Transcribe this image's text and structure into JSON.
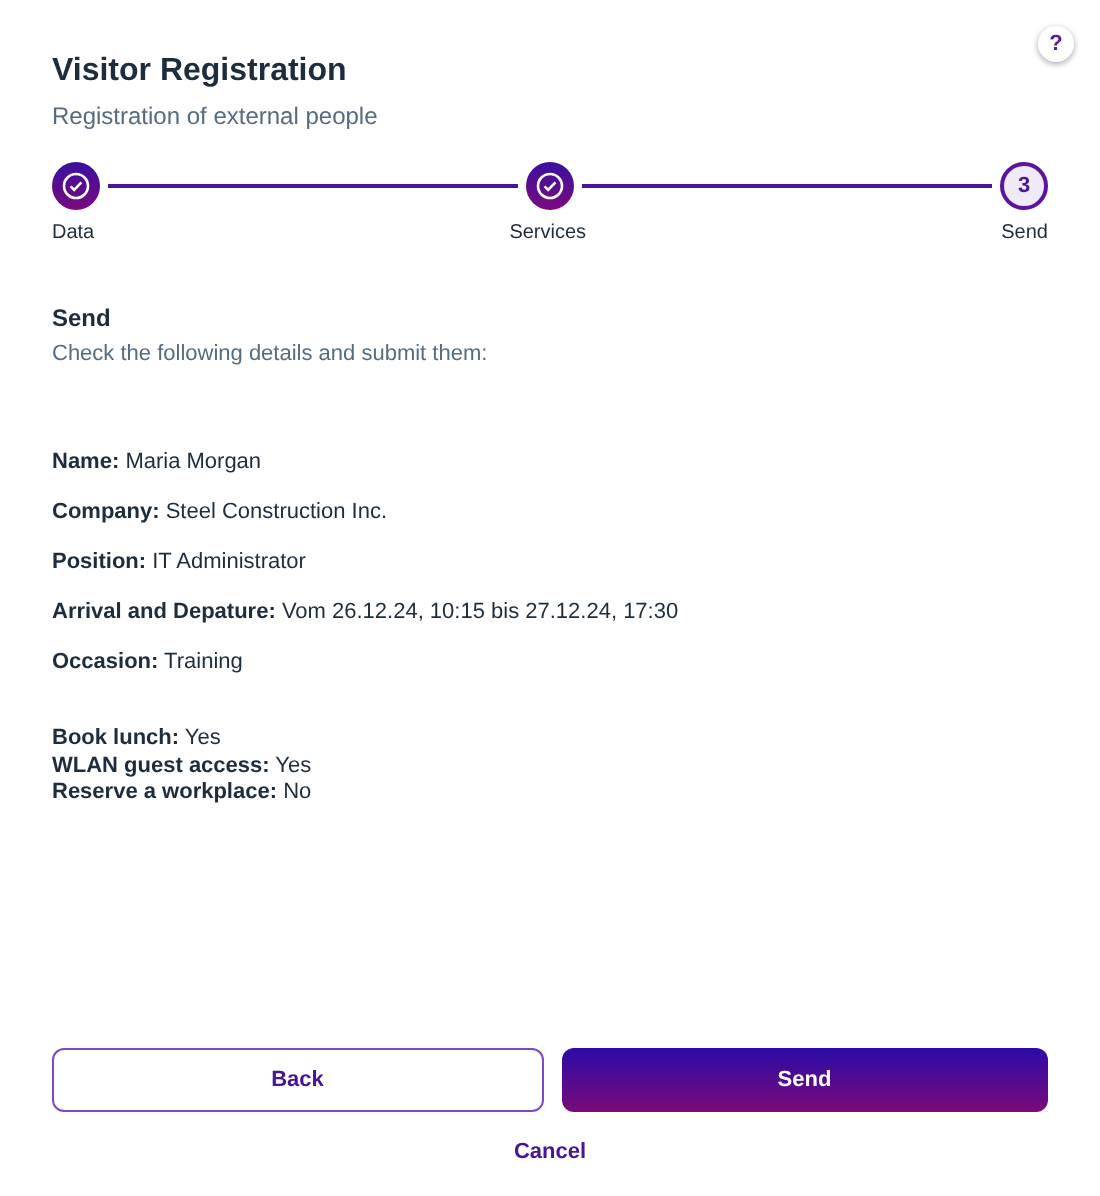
{
  "help_button": {
    "label": "?"
  },
  "header": {
    "title": "Visitor Registration",
    "subtitle": "Registration of external people"
  },
  "steps": [
    {
      "label": "Data",
      "completed": true
    },
    {
      "label": "Services",
      "completed": true
    },
    {
      "label": "Send",
      "number": "3",
      "completed": false
    }
  ],
  "section": {
    "title": "Send",
    "description": "Check the following details and submit them:"
  },
  "details": [
    {
      "label": "Name:",
      "value": "Maria Morgan"
    },
    {
      "label": "Company:",
      "value": "Steel Construction Inc."
    },
    {
      "label": "Position:",
      "value": "IT Administrator"
    },
    {
      "label": "Arrival and Depature:",
      "value": "Vom 26.12.24, 10:15 bis 27.12.24, 17:30"
    },
    {
      "label": "Occasion:",
      "value": "Training"
    }
  ],
  "services": [
    {
      "label": "Book lunch:",
      "value": "Yes"
    },
    {
      "label": "WLAN guest access:",
      "value": "Yes"
    },
    {
      "label": "Reserve a workplace:",
      "value": "No"
    }
  ],
  "buttons": {
    "back": "Back",
    "send": "Send",
    "cancel": "Cancel"
  }
}
